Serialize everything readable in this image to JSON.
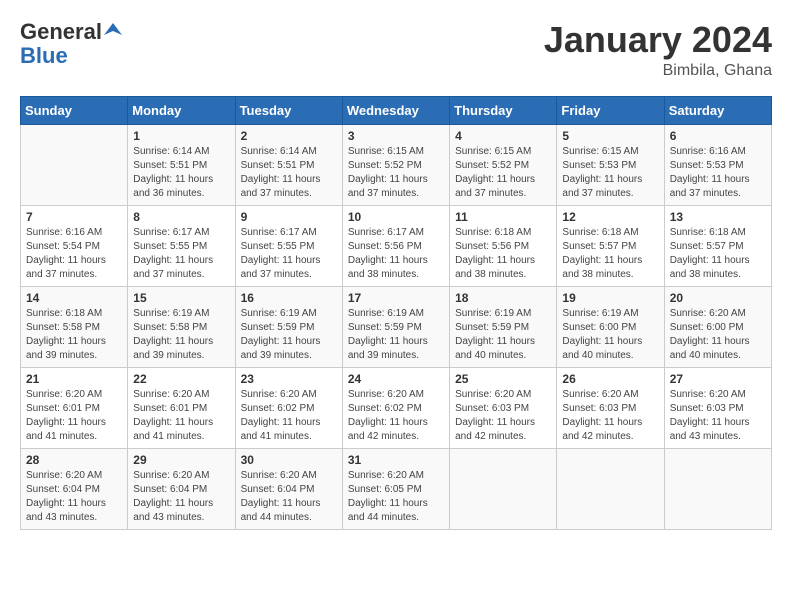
{
  "header": {
    "logo_general": "General",
    "logo_blue": "Blue",
    "title": "January 2024",
    "location": "Bimbila, Ghana"
  },
  "days_of_week": [
    "Sunday",
    "Monday",
    "Tuesday",
    "Wednesday",
    "Thursday",
    "Friday",
    "Saturday"
  ],
  "weeks": [
    [
      {
        "num": "",
        "sunrise": "",
        "sunset": "",
        "daylight": ""
      },
      {
        "num": "1",
        "sunrise": "6:14 AM",
        "sunset": "5:51 PM",
        "daylight": "11 hours and 36 minutes."
      },
      {
        "num": "2",
        "sunrise": "6:14 AM",
        "sunset": "5:51 PM",
        "daylight": "11 hours and 37 minutes."
      },
      {
        "num": "3",
        "sunrise": "6:15 AM",
        "sunset": "5:52 PM",
        "daylight": "11 hours and 37 minutes."
      },
      {
        "num": "4",
        "sunrise": "6:15 AM",
        "sunset": "5:52 PM",
        "daylight": "11 hours and 37 minutes."
      },
      {
        "num": "5",
        "sunrise": "6:15 AM",
        "sunset": "5:53 PM",
        "daylight": "11 hours and 37 minutes."
      },
      {
        "num": "6",
        "sunrise": "6:16 AM",
        "sunset": "5:53 PM",
        "daylight": "11 hours and 37 minutes."
      }
    ],
    [
      {
        "num": "7",
        "sunrise": "6:16 AM",
        "sunset": "5:54 PM",
        "daylight": "11 hours and 37 minutes."
      },
      {
        "num": "8",
        "sunrise": "6:17 AM",
        "sunset": "5:55 PM",
        "daylight": "11 hours and 37 minutes."
      },
      {
        "num": "9",
        "sunrise": "6:17 AM",
        "sunset": "5:55 PM",
        "daylight": "11 hours and 37 minutes."
      },
      {
        "num": "10",
        "sunrise": "6:17 AM",
        "sunset": "5:56 PM",
        "daylight": "11 hours and 38 minutes."
      },
      {
        "num": "11",
        "sunrise": "6:18 AM",
        "sunset": "5:56 PM",
        "daylight": "11 hours and 38 minutes."
      },
      {
        "num": "12",
        "sunrise": "6:18 AM",
        "sunset": "5:57 PM",
        "daylight": "11 hours and 38 minutes."
      },
      {
        "num": "13",
        "sunrise": "6:18 AM",
        "sunset": "5:57 PM",
        "daylight": "11 hours and 38 minutes."
      }
    ],
    [
      {
        "num": "14",
        "sunrise": "6:18 AM",
        "sunset": "5:58 PM",
        "daylight": "11 hours and 39 minutes."
      },
      {
        "num": "15",
        "sunrise": "6:19 AM",
        "sunset": "5:58 PM",
        "daylight": "11 hours and 39 minutes."
      },
      {
        "num": "16",
        "sunrise": "6:19 AM",
        "sunset": "5:59 PM",
        "daylight": "11 hours and 39 minutes."
      },
      {
        "num": "17",
        "sunrise": "6:19 AM",
        "sunset": "5:59 PM",
        "daylight": "11 hours and 39 minutes."
      },
      {
        "num": "18",
        "sunrise": "6:19 AM",
        "sunset": "5:59 PM",
        "daylight": "11 hours and 40 minutes."
      },
      {
        "num": "19",
        "sunrise": "6:19 AM",
        "sunset": "6:00 PM",
        "daylight": "11 hours and 40 minutes."
      },
      {
        "num": "20",
        "sunrise": "6:20 AM",
        "sunset": "6:00 PM",
        "daylight": "11 hours and 40 minutes."
      }
    ],
    [
      {
        "num": "21",
        "sunrise": "6:20 AM",
        "sunset": "6:01 PM",
        "daylight": "11 hours and 41 minutes."
      },
      {
        "num": "22",
        "sunrise": "6:20 AM",
        "sunset": "6:01 PM",
        "daylight": "11 hours and 41 minutes."
      },
      {
        "num": "23",
        "sunrise": "6:20 AM",
        "sunset": "6:02 PM",
        "daylight": "11 hours and 41 minutes."
      },
      {
        "num": "24",
        "sunrise": "6:20 AM",
        "sunset": "6:02 PM",
        "daylight": "11 hours and 42 minutes."
      },
      {
        "num": "25",
        "sunrise": "6:20 AM",
        "sunset": "6:03 PM",
        "daylight": "11 hours and 42 minutes."
      },
      {
        "num": "26",
        "sunrise": "6:20 AM",
        "sunset": "6:03 PM",
        "daylight": "11 hours and 42 minutes."
      },
      {
        "num": "27",
        "sunrise": "6:20 AM",
        "sunset": "6:03 PM",
        "daylight": "11 hours and 43 minutes."
      }
    ],
    [
      {
        "num": "28",
        "sunrise": "6:20 AM",
        "sunset": "6:04 PM",
        "daylight": "11 hours and 43 minutes."
      },
      {
        "num": "29",
        "sunrise": "6:20 AM",
        "sunset": "6:04 PM",
        "daylight": "11 hours and 43 minutes."
      },
      {
        "num": "30",
        "sunrise": "6:20 AM",
        "sunset": "6:04 PM",
        "daylight": "11 hours and 44 minutes."
      },
      {
        "num": "31",
        "sunrise": "6:20 AM",
        "sunset": "6:05 PM",
        "daylight": "11 hours and 44 minutes."
      },
      {
        "num": "",
        "sunrise": "",
        "sunset": "",
        "daylight": ""
      },
      {
        "num": "",
        "sunrise": "",
        "sunset": "",
        "daylight": ""
      },
      {
        "num": "",
        "sunrise": "",
        "sunset": "",
        "daylight": ""
      }
    ]
  ],
  "labels": {
    "sunrise": "Sunrise:",
    "sunset": "Sunset:",
    "daylight": "Daylight:"
  }
}
